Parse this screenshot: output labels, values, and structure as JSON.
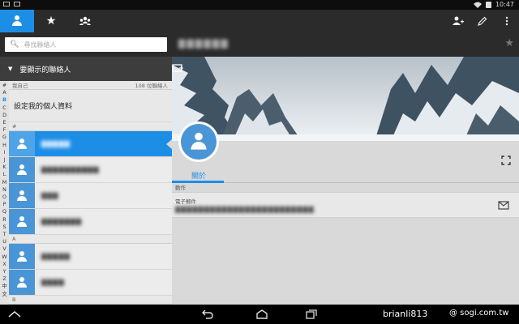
{
  "status": {
    "time": "10:47"
  },
  "tabs": [
    {
      "name": "contacts-tab",
      "icon": "person-icon"
    },
    {
      "name": "favorites-tab",
      "icon": "star-icon"
    },
    {
      "name": "groups-tab",
      "icon": "group-icon"
    }
  ],
  "actionbar": {
    "icons": [
      "add-contact-icon",
      "edit-icon",
      "more-icon"
    ]
  },
  "search": {
    "placeholder": "尋找聯絡人"
  },
  "group_header": {
    "label": "要顯示的聯絡人"
  },
  "alphabet": [
    "#",
    "A",
    "B",
    "C",
    "D",
    "E",
    "F",
    "G",
    "H",
    "I",
    "J",
    "K",
    "L",
    "M",
    "N",
    "O",
    "P",
    "Q",
    "R",
    "S",
    "T",
    "U",
    "V",
    "W",
    "X",
    "Y",
    "Z",
    "中",
    "文"
  ],
  "list": {
    "me_header": "我自己",
    "count": "108 位聯絡人",
    "my_profile": "設定我的個人資料",
    "section_hash": "#",
    "section_a": "A",
    "section_b": "B",
    "contacts_hash": [
      "▇▇▇▇▇",
      "▇▇▇▇▇▇▇▇▇▇",
      "▇▇▇",
      "▇▇▇▇▇▇▇"
    ],
    "contacts_a": [
      "▇▇▇▇▇",
      "▇▇▇▇"
    ]
  },
  "detail": {
    "name": "▇▇▇▇▇▇",
    "tab_label": "關於",
    "actions_label": "動作",
    "email_label": "電子郵件",
    "email_value": "▇▇▇▇▇▇▇▇▇▇▇▇▇▇▇▇▇▇▇▇▇▇▇▇"
  },
  "watermark": {
    "left": "brianli813",
    "right": "@ sogi.com.tw"
  },
  "colors": {
    "accent": "#1d8ee6",
    "avatar": "#4a95d6",
    "bar": "#2b2b2b"
  }
}
